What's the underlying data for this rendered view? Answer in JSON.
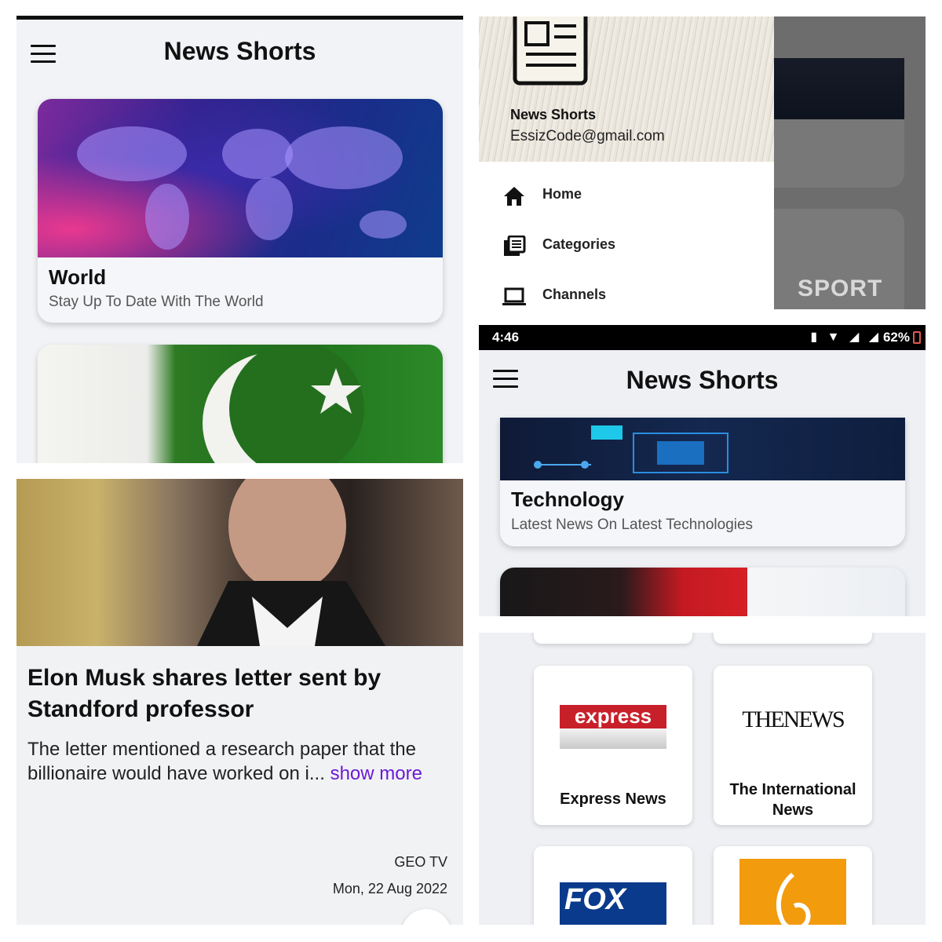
{
  "app": {
    "title": "News Shorts"
  },
  "home": {
    "cards": [
      {
        "title": "World",
        "subtitle": "Stay Up To Date With The World"
      }
    ]
  },
  "drawer": {
    "app_name": "News Shorts",
    "email": "EssizCode@gmail.com",
    "items": [
      {
        "label": "Home",
        "icon": "home-icon"
      },
      {
        "label": "Categories",
        "icon": "categories-icon"
      },
      {
        "label": "Channels",
        "icon": "laptop-icon"
      }
    ],
    "background_card_label": "SPORT"
  },
  "status_bar": {
    "time": "4:46",
    "battery": "62%"
  },
  "categories": {
    "cards": [
      {
        "title": "Technology",
        "subtitle": "Latest News On Latest Technologies"
      }
    ]
  },
  "article": {
    "title": "Elon Musk shares letter sent by Standford professor",
    "description": "The letter mentioned a research paper that the billionaire would have worked on i...",
    "more_label": "show more",
    "source": "GEO TV",
    "date": "Mon, 22 Aug 2022"
  },
  "channels": {
    "items": [
      {
        "name": "Express News",
        "logo_text": "express"
      },
      {
        "name": "The International News",
        "logo_text": "THENEWS"
      },
      {
        "name": "",
        "logo_text": "FOX"
      },
      {
        "name": "",
        "logo_text": ""
      }
    ]
  },
  "colors": {
    "link": "#6a1bd6",
    "express_red": "#c8202a",
    "fox_blue": "#0a3a8c",
    "aljazeera_orange": "#f29b0d",
    "status_bar": "#000000",
    "background": "#f1f3f6"
  }
}
